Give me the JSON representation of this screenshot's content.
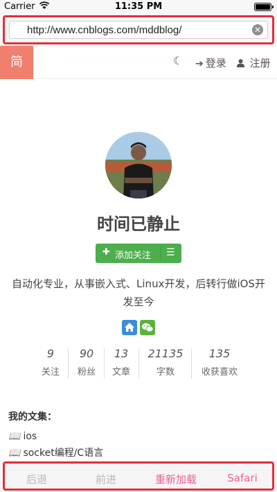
{
  "status_bar": {
    "carrier": "Carrier",
    "time": "11:35 PM",
    "battery_percent": 100
  },
  "browser": {
    "url": "http://www.cnblogs.com/mddblog/",
    "highlight_color": "#e0303a"
  },
  "header": {
    "simplified_label": "简",
    "login_label": "登录",
    "register_label": "注册",
    "brand_color": "#f07f6e"
  },
  "profile": {
    "name": "时间已静止",
    "follow_label": "添加关注",
    "bio": "自动化专业，从事嵌入式、Linux开发，后转行做iOS开发至今"
  },
  "stats": [
    {
      "value": "9",
      "label": "关注"
    },
    {
      "value": "90",
      "label": "粉丝"
    },
    {
      "value": "13",
      "label": "文章"
    },
    {
      "value": "21135",
      "label": "字数"
    },
    {
      "value": "135",
      "label": "收获喜欢"
    }
  ],
  "collections": {
    "title": "我的文集：",
    "items": [
      "ios",
      "socket编程/C语言"
    ]
  },
  "toolbar": {
    "back_label": "后退",
    "forward_label": "前进",
    "reload_label": "重新加载",
    "safari_label": "Safari",
    "active_color": "#f0608e"
  }
}
